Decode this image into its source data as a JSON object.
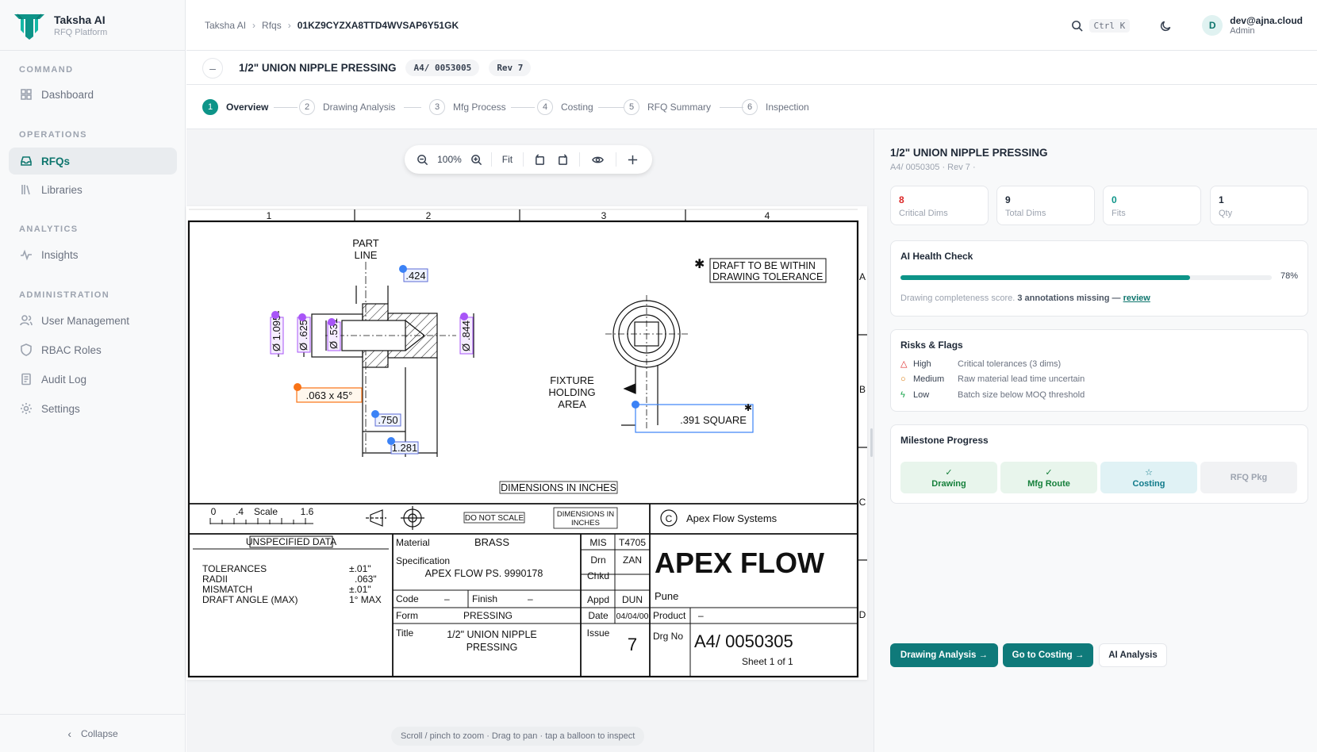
{
  "app": {
    "name": "Taksha AI",
    "subtitle": "RFQ Platform"
  },
  "sidebar": {
    "sections": [
      {
        "label": "COMMAND"
      },
      {
        "label": "OPERATIONS"
      },
      {
        "label": "ANALYTICS"
      },
      {
        "label": "ADMINISTRATION"
      }
    ],
    "items": [
      {
        "label": "Dashboard",
        "icon": "grid-icon"
      },
      {
        "label": "RFQs",
        "icon": "inbox-icon",
        "active": true
      },
      {
        "label": "Libraries",
        "icon": "library-icon"
      },
      {
        "label": "Insights",
        "icon": "activity-icon"
      },
      {
        "label": "User Management",
        "icon": "users-icon"
      },
      {
        "label": "RBAC Roles",
        "icon": "shield-icon"
      },
      {
        "label": "Audit Log",
        "icon": "log-icon"
      },
      {
        "label": "Settings",
        "icon": "gear-icon"
      }
    ],
    "collapse_label": "Collapse"
  },
  "breadcrumb": {
    "items": [
      "Taksha AI",
      "Rfqs",
      "01KZ9CYZXA8TTD4WVSAP6Y51GK"
    ]
  },
  "topbar": {
    "shortcut": "Ctrl K",
    "user_initial": "D",
    "user_email": "dev@ajna.cloud",
    "user_role": "Admin"
  },
  "titlebar": {
    "back": "–",
    "title": "1/2\" UNION NIPPLE PRESSING",
    "drawing_no": "A4/ 0053005",
    "rev": "Rev 7"
  },
  "steps": [
    {
      "num": "1",
      "label": "Overview",
      "active": true
    },
    {
      "num": "2",
      "label": "Drawing Analysis"
    },
    {
      "num": "3",
      "label": "Mfg Process"
    },
    {
      "num": "4",
      "label": "Costing"
    },
    {
      "num": "5",
      "label": "RFQ Summary"
    },
    {
      "num": "6",
      "label": "Inspection"
    }
  ],
  "viewer": {
    "zoom": "100%",
    "fit": "Fit",
    "hint": "Scroll / pinch to zoom · Drag to pan · tap a balloon to inspect"
  },
  "drawing": {
    "columns": [
      "1",
      "2",
      "3",
      "4"
    ],
    "rows": [
      "A",
      "B",
      "C",
      "D"
    ],
    "part_line": [
      "PART",
      "LINE"
    ],
    "dims": {
      "d424": ".424",
      "d1095": "Ø 1.095",
      "d625": "Ø .625",
      "d531": "Ø .531",
      "d844": "Ø .844",
      "chamfer": ".063 x 45°",
      "d750": ".750",
      "d1281": "1.281",
      "square": ".391 SQUARE"
    },
    "draft_note": [
      "DRAFT TO BE WITHIN",
      "DRAWING TOLERANCE"
    ],
    "fixture": [
      "FIXTURE",
      "HOLDING",
      "AREA"
    ],
    "units_note": "DIMENSIONS IN INCHES",
    "scale": {
      "ticks": [
        "0",
        ".4",
        "Scale",
        "1.6"
      ]
    },
    "do_not_scale": "DO NOT SCALE",
    "dims_in_inches": [
      "DIMENSIONS IN",
      "INCHES"
    ],
    "company_copy": "Apex Flow Systems",
    "logo_text": "APEX FLOW",
    "city": "Pune",
    "unspecified": "UNSPECIFIED DATA",
    "tolerances": [
      {
        "k": "TOLERANCES",
        "v": "±.01\""
      },
      {
        "k": "RADII",
        "v": ".063\""
      },
      {
        "k": "MISMATCH",
        "v": "±.01\""
      },
      {
        "k": "DRAFT ANGLE (MAX)",
        "v": "1° MAX"
      }
    ],
    "material_label": "Material",
    "material": "BRASS",
    "spec_label": "Specification",
    "spec": "APEX FLOW PS. 9990178",
    "code_label": "Code",
    "code": "–",
    "finish_label": "Finish",
    "finish": "–",
    "form_label": "Form",
    "form": "PRESSING",
    "title_label": "Title",
    "title_l1": "1/2\" UNION NIPPLE",
    "title_l2": "PRESSING",
    "mis_label": "MIS",
    "mis": "T4705",
    "drn_label": "Drn",
    "drn": "ZAN",
    "chkd_label": "Chkd",
    "chkd": "",
    "appd_label": "Appd",
    "appd": "DUN",
    "date_label": "Date",
    "date": "04/04/00",
    "issue_label": "Issue",
    "issue": "7",
    "product_label": "Product",
    "product": "–",
    "drg_label": "Drg No",
    "drg_no": "A4/ 0050305",
    "sheet": "Sheet 1 of 1"
  },
  "panel": {
    "title": "1/2\" UNION NIPPLE PRESSING",
    "subtitle": "A4/ 0050305 · Rev 7 ·",
    "stats": [
      {
        "value": "8",
        "label": "Critical Dims",
        "color": "#dc2626"
      },
      {
        "value": "9",
        "label": "Total Dims",
        "color": "#1f2937"
      },
      {
        "value": "0",
        "label": "Fits",
        "color": "#0d9488"
      },
      {
        "value": "1",
        "label": "Qty",
        "color": "#1f2937"
      }
    ],
    "health": {
      "title": "AI Health Check",
      "percent": 78,
      "percent_label": "78%",
      "note_prefix": "Drawing completeness score.",
      "note_strong": "3 annotations missing —",
      "note_link": "review"
    },
    "risks": {
      "title": "Risks & Flags",
      "items": [
        {
          "level": "High",
          "text": "Critical tolerances (3 dims)",
          "color": "#dc2626"
        },
        {
          "level": "Medium",
          "text": "Raw material lead time uncertain",
          "color": "#d97706"
        },
        {
          "level": "Low",
          "text": "Batch size below MOQ threshold",
          "color": "#16a34a"
        }
      ]
    },
    "milestones": {
      "title": "Milestone Progress",
      "items": [
        {
          "label": "Drawing",
          "state": "done"
        },
        {
          "label": "Mfg Route",
          "state": "done"
        },
        {
          "label": "Costing",
          "state": "current"
        },
        {
          "label": "RFQ Pkg",
          "state": "pending"
        }
      ]
    },
    "actions": {
      "drawing_analysis": "Drawing Analysis →",
      "go_costing": "Go to Costing →",
      "ai_analysis": "AI Analysis"
    }
  }
}
